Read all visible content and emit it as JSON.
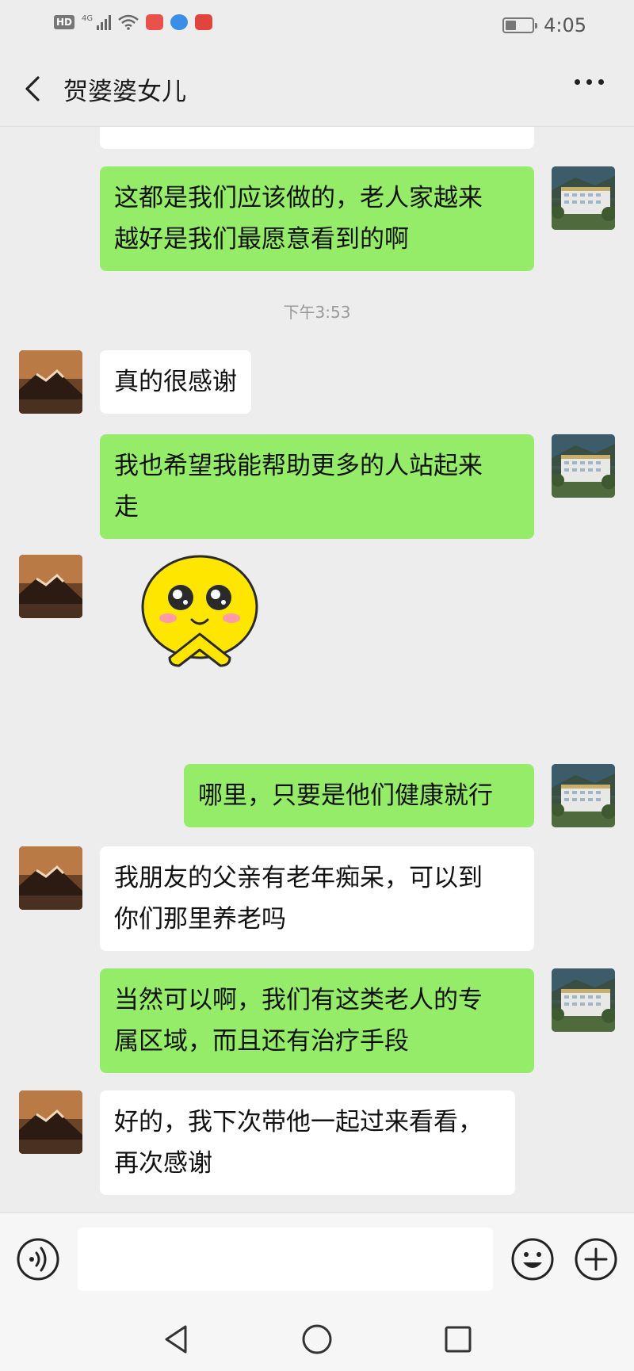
{
  "status_bar": {
    "network": "HD",
    "signal_label": "4G",
    "time": "4:05",
    "battery_level": 0.4,
    "icons": [
      "hd-icon",
      "signal-icon",
      "wifi-icon",
      "app-notification-icon",
      "app-notification-icon",
      "app-notification-icon",
      "battery-icon"
    ]
  },
  "header": {
    "title": "贺婆婆女儿",
    "back_icon": "back-arrow-icon",
    "more_icon": "more-icon"
  },
  "messages": [
    {
      "sender": "me",
      "lines": [
        "这都是我们应该做的，老人家越来",
        "越好是我们最愿意看到的啊"
      ]
    },
    {
      "type": "timestamp",
      "text": "下午3:53"
    },
    {
      "sender": "them",
      "lines": [
        "真的很感谢"
      ]
    },
    {
      "sender": "me",
      "lines": [
        "我也希望我能帮助更多的人站起来",
        "走"
      ]
    },
    {
      "sender": "them",
      "type": "sticker",
      "sticker": "smiling-emoji-sticker"
    },
    {
      "sender": "me",
      "lines": [
        "哪里，只要是他们健康就行"
      ]
    },
    {
      "sender": "them",
      "lines": [
        "我朋友的父亲有老年痴呆，可以到",
        "你们那里养老吗"
      ]
    },
    {
      "sender": "me",
      "lines": [
        "当然可以啊，我们有这类老人的专",
        "属区域，而且还有治疗手段"
      ]
    },
    {
      "sender": "them",
      "lines": [
        "好的，我下次带他一起过来看看，",
        "再次感谢"
      ]
    }
  ],
  "input_bar": {
    "text": "",
    "icons": [
      "voice-icon",
      "emoji-icon",
      "plus-icon"
    ]
  },
  "nav_bar": {
    "icons": [
      "nav-back-icon",
      "nav-home-icon",
      "nav-recent-icon"
    ]
  },
  "colors": {
    "my_bubble": "#95ec69",
    "their_bubble": "#ffffff",
    "background": "#ededed"
  }
}
